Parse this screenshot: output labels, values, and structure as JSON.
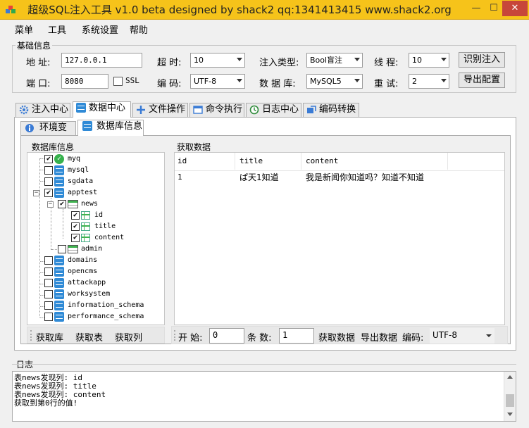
{
  "window": {
    "title": "超级SQL注入工具 v1.0 beta designed by shack2 qq:1341413415 www.shack2.org",
    "min": "—",
    "max": "☐",
    "close": "✕"
  },
  "menu": [
    "菜单",
    "工具",
    "系统设置",
    "帮助"
  ],
  "basic": {
    "legend": "基础信息",
    "address_label": "地 址:",
    "address_value": "127.0.0.1",
    "timeout_label": "超 时:",
    "timeout_value": "10",
    "inject_type_label": "注入类型:",
    "inject_type_value": "Bool盲注",
    "threads_label": "线 程:",
    "threads_value": "10",
    "identify_button": "识别注入",
    "port_label": "端 口:",
    "port_value": "8080",
    "ssl_label": "SSL",
    "encoding_label": "编 码:",
    "encoding_value": "UTF-8",
    "database_label": "数 据 库:",
    "database_value": "MySQL5",
    "retry_label": "重 试:",
    "retry_value": "2",
    "export_button": "导出配置"
  },
  "tabs": [
    {
      "label": "注入中心",
      "active": false
    },
    {
      "label": "数据中心",
      "active": true
    },
    {
      "label": "文件操作",
      "active": false
    },
    {
      "label": "命令执行",
      "active": false
    },
    {
      "label": "日志中心",
      "active": false
    },
    {
      "label": "编码转换",
      "active": false
    }
  ],
  "subtabs": [
    {
      "label": "环境变量",
      "active": false
    },
    {
      "label": "数据库信息",
      "active": true
    }
  ],
  "dbinfo": {
    "legend": "数据库信息",
    "tree": {
      "root": "myq",
      "databases": [
        "mysql",
        "sgdata",
        "apptest",
        "domains",
        "opencms",
        "attackapp",
        "worksystem",
        "information_schema",
        "performance_schema"
      ],
      "tables": [
        "news",
        "admin"
      ],
      "columns": [
        "id",
        "title",
        "content"
      ]
    },
    "toolbar": [
      "获取库",
      "获取表",
      "获取列"
    ]
  },
  "fetch": {
    "legend": "获取数据",
    "columns": [
      "id",
      "title",
      "content"
    ],
    "rows": [
      [
        "1",
        "ぱ天1知道",
        "我是新闻你知道吗？知道不知道"
      ]
    ],
    "toolbar": {
      "start_label": "开 始:",
      "start_value": "0",
      "count_label": "条 数:",
      "count_value": "1",
      "get_data": "获取数据",
      "export_data": "导出数据",
      "encoding_label": "编码:",
      "encoding_value": "UTF-8"
    }
  },
  "log": {
    "legend": "日志",
    "lines": [
      "表news发现列: id",
      "表news发现列: title",
      "表news发现列: content",
      "获取到第0行的值!"
    ]
  },
  "colors": {
    "titlebar": "#f6c31a",
    "db_icon": "#2f8ad6",
    "table_icon": "#3fb34f",
    "close_button": "#c7463a"
  }
}
